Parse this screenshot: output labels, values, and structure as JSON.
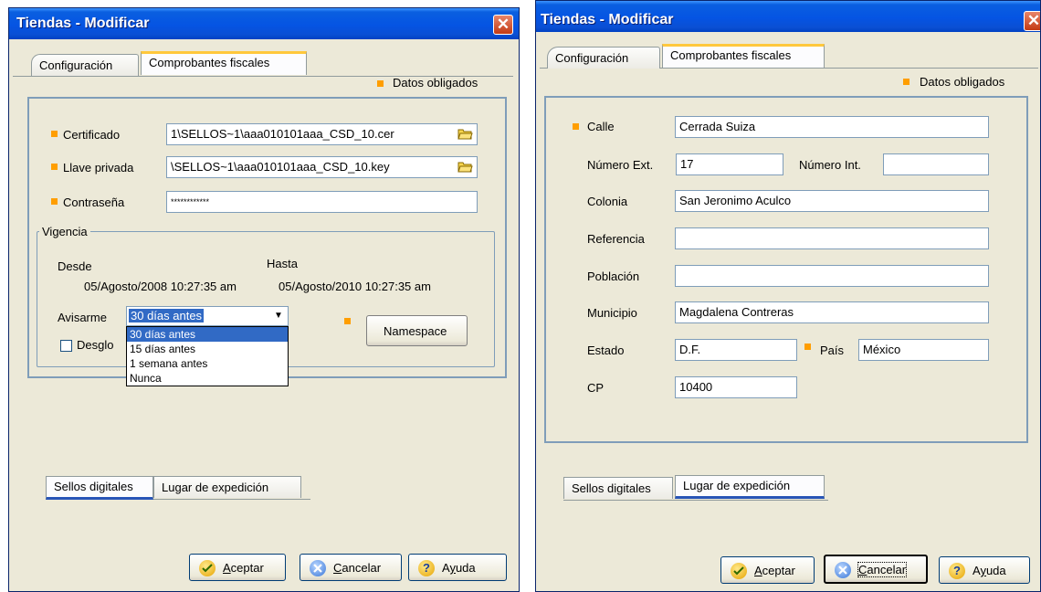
{
  "left_window": {
    "title": "Tiendas - Modificar",
    "tabs": {
      "config": "Configuración",
      "comprobantes": "Comprobantes fiscales"
    },
    "required_note": "Datos obligados",
    "certificado": {
      "label": "Certificado",
      "value": "1\\SELLOS~1\\aaa010101aaa_CSD_10.cer"
    },
    "llave": {
      "label": "Llave privada",
      "value": "\\SELLOS~1\\aaa010101aaa_CSD_10.key"
    },
    "contrasena": {
      "label": "Contraseña",
      "value": "************"
    },
    "vigencia": {
      "legend": "Vigencia",
      "desde_label": "Desde",
      "hasta_label": "Hasta",
      "desde_value": "05/Agosto/2008 10:27:35 am",
      "hasta_value": "05/Agosto/2010 10:27:35 am"
    },
    "avisarme": {
      "label": "Avisarme",
      "value": "30 días antes",
      "options": [
        "30 días antes",
        "15 días antes",
        "1 semana antes",
        "Nunca"
      ]
    },
    "desglose_label": "Desglo",
    "namespace_button": "Namespace",
    "bottom_tabs": {
      "sellos": "Sellos digitales",
      "lugar": "Lugar de expedición"
    },
    "buttons": {
      "aceptar_u": "A",
      "aceptar_rest": "ceptar",
      "cancelar_u": "C",
      "cancelar_rest": "ancelar",
      "ayuda_pre": "A",
      "ayuda_u": "y",
      "ayuda_rest": "uda"
    }
  },
  "right_window": {
    "title": "Tiendas - Modificar",
    "tabs": {
      "config": "Configuración",
      "comprobantes": "Comprobantes fiscales"
    },
    "required_note": "Datos obligados",
    "calle": {
      "label": "Calle",
      "value": "Cerrada Suiza"
    },
    "num_ext": {
      "label": "Número Ext.",
      "value": "17"
    },
    "num_int": {
      "label": "Número Int.",
      "value": ""
    },
    "colonia": {
      "label": "Colonia",
      "value": "San Jeronimo Aculco"
    },
    "referencia": {
      "label": "Referencia",
      "value": ""
    },
    "poblacion": {
      "label": "Población",
      "value": ""
    },
    "municipio": {
      "label": "Municipio",
      "value": "Magdalena Contreras"
    },
    "estado": {
      "label": "Estado",
      "value": "D.F."
    },
    "pais": {
      "label": "País",
      "value": "México"
    },
    "cp": {
      "label": "CP",
      "value": "10400"
    },
    "bottom_tabs": {
      "sellos": "Sellos digitales",
      "lugar": "Lugar de expedición"
    },
    "buttons": {
      "aceptar_u": "A",
      "aceptar_rest": "ceptar",
      "cancelar_u": "C",
      "cancelar_rest": "ancelar",
      "ayuda_pre": "A",
      "ayuda_u": "y",
      "ayuda_rest": "uda"
    }
  }
}
